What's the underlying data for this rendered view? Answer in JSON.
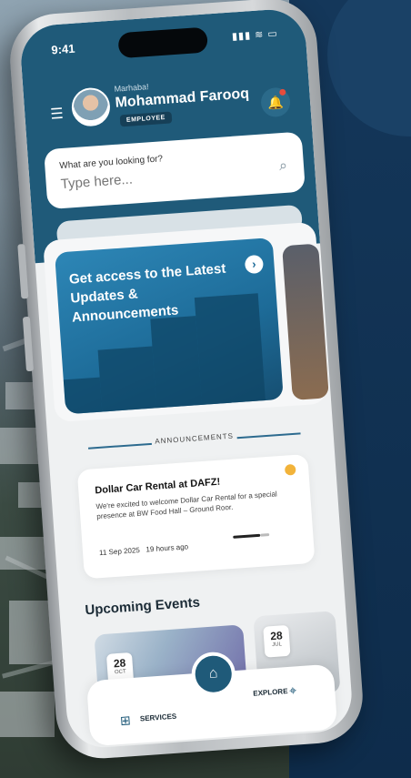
{
  "status_bar": {
    "time": "9:41",
    "indicators": "▮▮▮ ≋ ▭"
  },
  "header": {
    "greeting": "Marhaba!",
    "user_name": "Mohammad Farooq",
    "role_badge": "EMPLOYEE",
    "menu_icon": "menu-icon",
    "notification_icon": "bell-icon"
  },
  "search": {
    "label": "What are you looking for?",
    "placeholder": "Type here..."
  },
  "banner": {
    "title": "Get access to the Latest Updates & Announcements"
  },
  "announcements": {
    "section_label": "ANNOUNCEMENTS",
    "item": {
      "title": "Dollar Car Rental at DAFZ!",
      "body": "We're excited to welcome Dollar Car Rental for a special presence at BW Food Hall – Ground Roor.",
      "date": "11 Sep 2025",
      "ago": "19 hours ago"
    }
  },
  "events": {
    "title": "Upcoming Events",
    "items": [
      {
        "day": "28",
        "month": "OCT"
      },
      {
        "day": "28",
        "month": "JUL"
      }
    ]
  },
  "bottom_nav": {
    "services_label": "SERVICES",
    "explore_label": "EXPLORE"
  },
  "colors": {
    "header": "#1f5a79",
    "navy_bg": "#14375a",
    "accent_dot": "#f2b33a"
  }
}
